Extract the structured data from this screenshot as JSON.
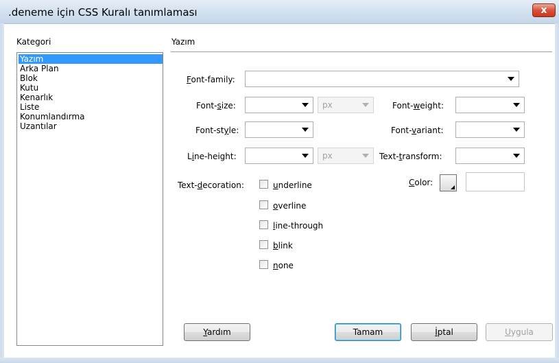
{
  "window": {
    "title": ".deneme için CSS Kuralı tanımlaması",
    "close_glyph": "x"
  },
  "category": {
    "title": "Kategori",
    "items": [
      "Yazım",
      "Arka Plan",
      "Blok",
      "Kutu",
      "Kenarlık",
      "Liste",
      "Konumlandırma",
      "Uzantılar"
    ],
    "selected": "Yazım"
  },
  "section": {
    "title": "Yazım"
  },
  "fields": {
    "font_family": {
      "pre": "",
      "key": "F",
      "post": "ont-family:",
      "value": ""
    },
    "font_size": {
      "pre": "Font-",
      "key": "s",
      "post": "ize:",
      "value": "",
      "unit": "px"
    },
    "font_style": {
      "pre": "Font-st",
      "key": "y",
      "post": "le:",
      "value": ""
    },
    "line_height": {
      "pre": "L",
      "key": "i",
      "post": "ne-height:",
      "value": "",
      "unit": "px"
    },
    "font_weight": {
      "pre": "Font-",
      "key": "w",
      "post": "eight:",
      "value": ""
    },
    "font_variant": {
      "pre": "Font-",
      "key": "v",
      "post": "ariant:",
      "value": ""
    },
    "text_transform": {
      "pre": "Text-",
      "key": "t",
      "post": "ransform:",
      "value": ""
    },
    "color": {
      "pre": "",
      "key": "C",
      "post": "olor:",
      "value": ""
    }
  },
  "text_decoration": {
    "label_pre": "Text-",
    "label_key": "d",
    "label_post": "ecoration:",
    "options": [
      {
        "key": "u",
        "rest": "nderline",
        "checked": false
      },
      {
        "key": "o",
        "rest": "verline",
        "checked": false
      },
      {
        "key": "l",
        "rest": "ine-through",
        "checked": false
      },
      {
        "key": "b",
        "rest": "link",
        "checked": false
      },
      {
        "key": "n",
        "rest": "one",
        "checked": false
      }
    ]
  },
  "buttons": {
    "help": {
      "key": "Y",
      "rest": "ardım"
    },
    "ok": "Tamam",
    "cancel": {
      "key": "İ",
      "rest": "ptal"
    },
    "apply": {
      "key": "U",
      "rest": "ygula"
    }
  }
}
